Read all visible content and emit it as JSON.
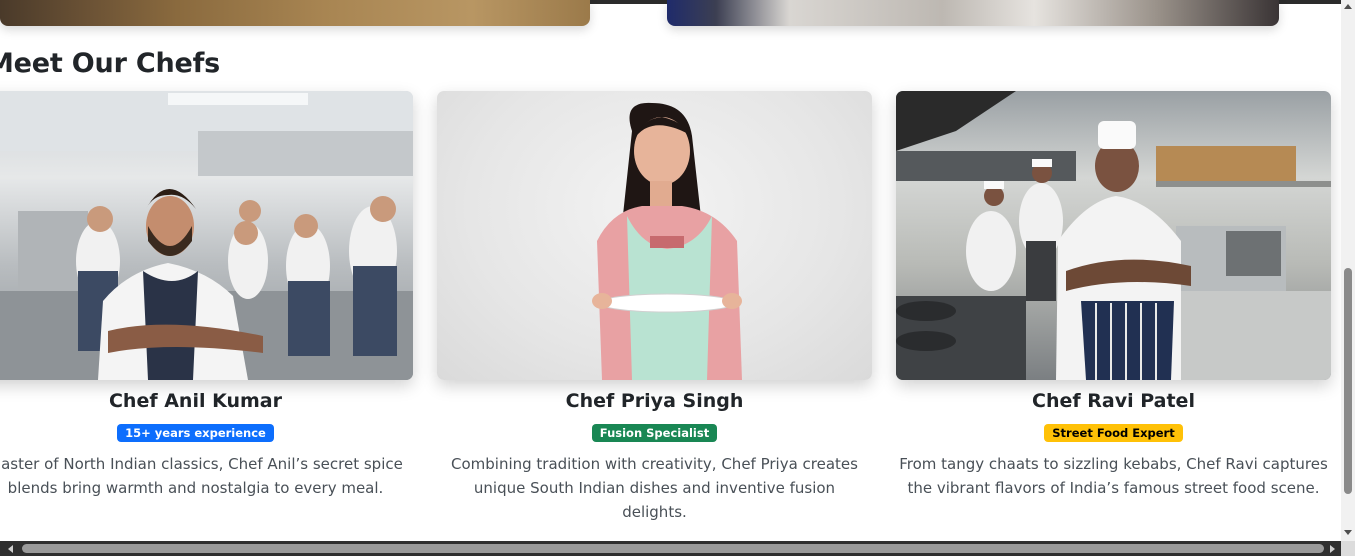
{
  "section": {
    "title": "Meet Our Chefs"
  },
  "chefs": [
    {
      "name": "Chef Anil Kumar",
      "badge": "15+ years experience",
      "badge_color": "#0d6efd",
      "badge_text_color": "#ffffff",
      "description": "Master of North Indian classics, Chef Anil’s secret spice blends bring warmth and nostalgia to every meal."
    },
    {
      "name": "Chef Priya Singh",
      "badge": "Fusion Specialist",
      "badge_color": "#198754",
      "badge_text_color": "#ffffff",
      "description": "Combining tradition with creativity, Chef Priya creates unique South Indian dishes and inventive fusion delights."
    },
    {
      "name": "Chef Ravi Patel",
      "badge": "Street Food Expert",
      "badge_color": "#ffc107",
      "badge_text_color": "#000000",
      "description": "From tangy chaats to sizzling kebabs, Chef Ravi captures the vibrant flavors of India’s famous street food scene."
    }
  ]
}
